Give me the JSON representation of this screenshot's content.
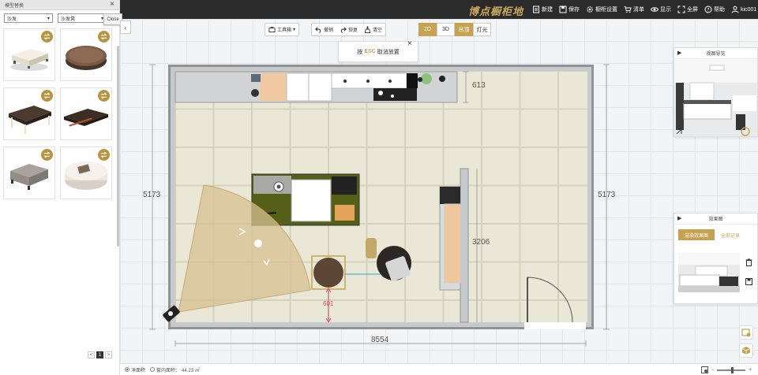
{
  "app": {
    "logo": "博点橱柜地"
  },
  "topmenu": [
    {
      "label": "新建",
      "icon": "new-file-icon"
    },
    {
      "label": "保存",
      "icon": "save-icon"
    },
    {
      "label": "橱柜设置",
      "icon": "gear-icon"
    },
    {
      "label": "清单",
      "icon": "cart-icon"
    },
    {
      "label": "显示",
      "icon": "eye-icon"
    },
    {
      "label": "全屏",
      "icon": "fullscreen-icon"
    },
    {
      "label": "帮助",
      "icon": "help-icon"
    },
    {
      "label": "kic001",
      "icon": "user-icon"
    }
  ],
  "left_panel": {
    "title": "模型替换",
    "close_glyph": "×",
    "close_tooltip": "Close",
    "select1": "沙发",
    "select2": "沙发凳",
    "products": [
      {
        "name": "white-ottoman"
      },
      {
        "name": "round-brown-pouf"
      },
      {
        "name": "tufted-bench"
      },
      {
        "name": "glass-coffee-table"
      },
      {
        "name": "gray-ottoman"
      },
      {
        "name": "round-white-table"
      }
    ],
    "pager": {
      "prev": "<",
      "current": "1",
      "next": ">"
    }
  },
  "toolbar": {
    "toolbox": "工具箱",
    "undo": "撤销",
    "redo": "恢复",
    "clear": "清空",
    "modes": [
      "2D",
      "3D",
      "吊顶",
      "灯光"
    ],
    "active_modes": [
      "2D",
      "吊顶"
    ]
  },
  "esc_tip": {
    "prefix": "按",
    "key": "ESC",
    "suffix": "取消放置",
    "close": "×"
  },
  "floorplan": {
    "dims": {
      "top_counter": "613",
      "left_height": "5173",
      "right_height": "5173",
      "partition": "3206",
      "width": "8554",
      "pouf_gap": "601"
    }
  },
  "view_nav": {
    "title": "视图导览"
  },
  "render_panel": {
    "title": "效果图",
    "render_button": "渲染效果图",
    "all_records": "全部记录"
  },
  "bottombar": {
    "area1": "净面积",
    "area2": "套内面积：",
    "area_value": "44.23 ㎡"
  },
  "colors": {
    "accent": "#c7a251",
    "topbar": "#2b2b2b"
  }
}
